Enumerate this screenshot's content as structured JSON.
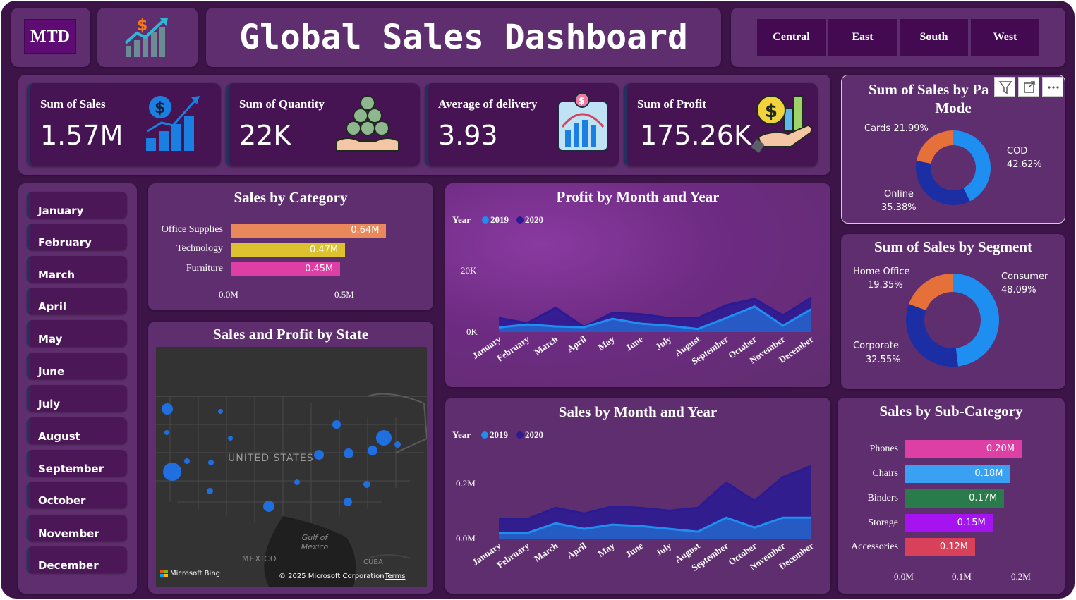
{
  "header": {
    "mtd_label": "MTD",
    "title": "Global Sales Dashboard",
    "logo_icon": "sales-growth-chart-icon",
    "regions": [
      "Central",
      "East",
      "South",
      "West"
    ]
  },
  "kpis": [
    {
      "label": "Sum of Sales",
      "value": "1.57M",
      "icon": "sales-chart-icon"
    },
    {
      "label": "Sum of Quantity",
      "value": "22K",
      "icon": "coins-hand-icon"
    },
    {
      "label": "Average of delivery",
      "value": "3.93",
      "icon": "delivery-chart-icon"
    },
    {
      "label": "Sum of Profit",
      "value": "175.26K",
      "icon": "profit-hand-icon"
    }
  ],
  "months": [
    "January",
    "February",
    "March",
    "April",
    "May",
    "June",
    "July",
    "August",
    "September",
    "October",
    "November",
    "December"
  ],
  "sales_by_category": {
    "title": "Sales by Category",
    "categories": [
      "Office Supplies",
      "Technology",
      "Furniture"
    ],
    "values": [
      0.64,
      0.47,
      0.45
    ],
    "value_labels": [
      "0.64M",
      "0.47M",
      "0.45M"
    ],
    "colors": [
      "#e9895b",
      "#dcc22e",
      "#de3fa4"
    ],
    "ticks": [
      "0.0M",
      "0.5M"
    ],
    "xlim": [
      0,
      0.7
    ]
  },
  "map": {
    "title": "Sales and Profit by State",
    "country_label": "UNITED STATES",
    "gulf_label": "Gulf of Mexico",
    "mexico_label": "MEXICO",
    "cuba_label": "CUBA",
    "attribution": "Microsoft Bing",
    "copyright": "© 2025 Microsoft Corporation",
    "terms": "Terms"
  },
  "profit_chart": {
    "title": "Profit by Month and Year",
    "legend_title": "Year",
    "series": [
      {
        "name": "2019",
        "color": "#1f8ef1",
        "values": [
          1800,
          3000,
          2200,
          1900,
          5200,
          3300,
          2500,
          1200,
          5500,
          10000,
          2500,
          9000
        ]
      },
      {
        "name": "2020",
        "color": "#2a1a94",
        "values": [
          5500,
          3500,
          9500,
          2000,
          7500,
          7000,
          5500,
          5500,
          10500,
          13000,
          6500,
          13500
        ]
      }
    ],
    "ylim": [
      0,
      24000
    ],
    "ytick_labels": [
      "0K",
      "20K"
    ]
  },
  "sales_chart": {
    "title": "Sales by Month and Year",
    "legend_title": "Year",
    "series": [
      {
        "name": "2019",
        "color": "#1f8ef1",
        "values": [
          0.02,
          0.02,
          0.055,
          0.035,
          0.05,
          0.045,
          0.035,
          0.025,
          0.075,
          0.04,
          0.075,
          0.075
        ]
      },
      {
        "name": "2020",
        "color": "#2a1a94",
        "values": [
          0.07,
          0.07,
          0.11,
          0.09,
          0.115,
          0.11,
          0.1,
          0.11,
          0.2,
          0.135,
          0.22,
          0.26
        ]
      }
    ],
    "ylim": [
      0,
      0.3
    ],
    "ytick_labels": [
      "0.0M",
      "0.2M"
    ]
  },
  "payment_mode": {
    "title": "Sum of Sales by Payment Mode",
    "title_visible": "Sum of Sales by Pa",
    "title_line2": "Mode",
    "slices": [
      {
        "name": "COD",
        "pct": 42.62,
        "label": "42.62%",
        "color": "#1f8ef1"
      },
      {
        "name": "Online",
        "pct": 35.38,
        "label": "35.38%",
        "color": "#1b2ea3"
      },
      {
        "name": "Cards",
        "pct": 21.99,
        "label": "21.99%",
        "color": "#e5703a"
      }
    ],
    "cards_label": "Cards 21.99%",
    "cod_label": "COD",
    "online_label": "Online"
  },
  "segment": {
    "title": "Sum of Sales by Segment",
    "slices": [
      {
        "name": "Consumer",
        "pct": 48.09,
        "label": "48.09%",
        "color": "#1f8ef1"
      },
      {
        "name": "Corporate",
        "pct": 32.55,
        "label": "32.55%",
        "color": "#1b2ea3"
      },
      {
        "name": "Home Office",
        "pct": 19.35,
        "label": "19.35%",
        "color": "#e5703a"
      }
    ]
  },
  "sub_category": {
    "title": "Sales by Sub-Category",
    "categories": [
      "Phones",
      "Chairs",
      "Binders",
      "Storage",
      "Accessories"
    ],
    "values": [
      0.2,
      0.18,
      0.17,
      0.15,
      0.12
    ],
    "value_labels": [
      "0.20M",
      "0.18M",
      "0.17M",
      "0.15M",
      "0.12M"
    ],
    "colors": [
      "#de3fa4",
      "#3aa0f2",
      "#2a7b4b",
      "#a413f0",
      "#d9405a"
    ],
    "ticks": [
      "0.0M",
      "0.1M",
      "0.2M"
    ],
    "xlim": [
      0,
      0.2
    ]
  },
  "visual_header_icons": [
    "filter-icon",
    "focus-mode-icon",
    "more-options-icon"
  ]
}
